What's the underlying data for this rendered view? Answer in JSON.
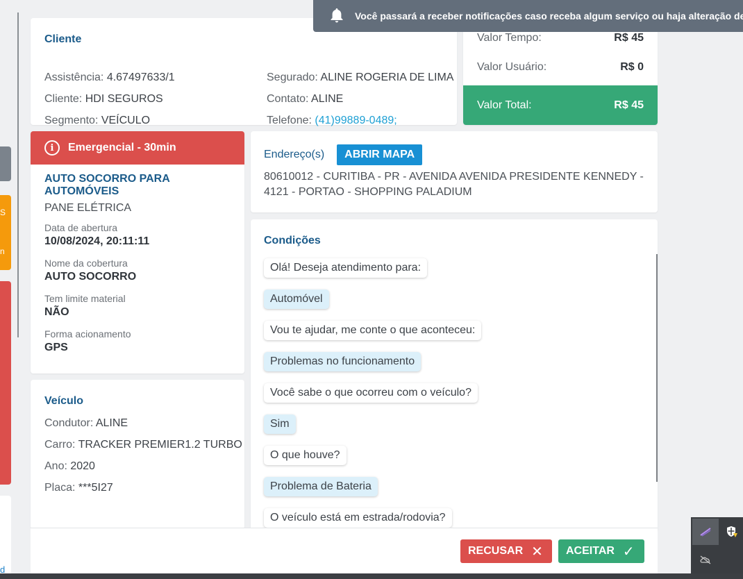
{
  "notification": {
    "text": "Você passará a receber notificações caso receba algum serviço ou haja alteração de algu"
  },
  "client": {
    "title": "Cliente",
    "left": [
      {
        "label": "Assistência: ",
        "value": "4.67497633/1"
      },
      {
        "label": "Cliente: ",
        "value": "HDI SEGUROS"
      },
      {
        "label": "Segmento: ",
        "value": "VEÍCULO"
      }
    ],
    "right": [
      {
        "label": "Segurado: ",
        "value": "ALINE ROGERIA DE LIMA"
      },
      {
        "label": "Contato: ",
        "value": "ALINE"
      },
      {
        "label": "Telefone: ",
        "value": "(41)99889-0489;"
      }
    ]
  },
  "values": {
    "time_label": "Valor Tempo:",
    "time_value": "R$ 45",
    "user_label": "Valor Usuário:",
    "user_value": "R$ 0",
    "total_label": "Valor Total:",
    "total_value": "R$ 45"
  },
  "emergency": {
    "header": "Emergencial - 30min",
    "service_title": "AUTO SOCORRO PARA AUTOMÓVEIS",
    "service_sub": "PANE ELÉTRICA",
    "fields": [
      {
        "label": "Data de abertura",
        "value": "10/08/2024, 20:11:11"
      },
      {
        "label": "Nome da cobertura",
        "value": "AUTO SOCORRO"
      },
      {
        "label": "Tem limite material",
        "value": "NÃO"
      },
      {
        "label": "Forma acionamento",
        "value": "GPS"
      }
    ]
  },
  "vehicle": {
    "title": "Veículo",
    "lines": [
      {
        "label": "Condutor: ",
        "value": "ALINE"
      },
      {
        "label": "Carro: ",
        "value": "TRACKER PREMIER1.2 TURBO"
      },
      {
        "label": "Ano: ",
        "value": "2020"
      },
      {
        "label": "Placa: ",
        "value": "***5I27"
      }
    ]
  },
  "address": {
    "title": "Endereço(s)",
    "map_button": "ABRIR MAPA",
    "text": "80610012 - CURITIBA - PR - AVENIDA AVENIDA PRESIDENTE KENNEDY - 4121 - PORTAO - SHOPPING PALADIUM"
  },
  "conditions": {
    "title": "Condições",
    "messages": [
      {
        "type": "q",
        "text": "Olá! Deseja atendimento para:"
      },
      {
        "type": "a",
        "text": "Automóvel"
      },
      {
        "type": "q",
        "text": "Vou te ajudar, me conte o que aconteceu:"
      },
      {
        "type": "a",
        "text": "Problemas no funcionamento"
      },
      {
        "type": "q",
        "text": "Você sabe o que ocorreu com o veículo?"
      },
      {
        "type": "a",
        "text": "Sim"
      },
      {
        "type": "q",
        "text": "O que houve?"
      },
      {
        "type": "a",
        "text": "Problema de Bateria"
      },
      {
        "type": "q",
        "text": "O veículo está em estrada/rodovia?"
      }
    ]
  },
  "actions": {
    "reject_label": "RECUSAR",
    "accept_label": "ACEITAR"
  },
  "left_tabs": {
    "orange_a": "S",
    "orange_b": "n",
    "white_c": "d"
  },
  "colors": {
    "danger": "#db4f4c",
    "success": "#36a877",
    "primary": "#1890d4",
    "title": "#1b5b8a",
    "notification_bg": "#636e7b"
  }
}
